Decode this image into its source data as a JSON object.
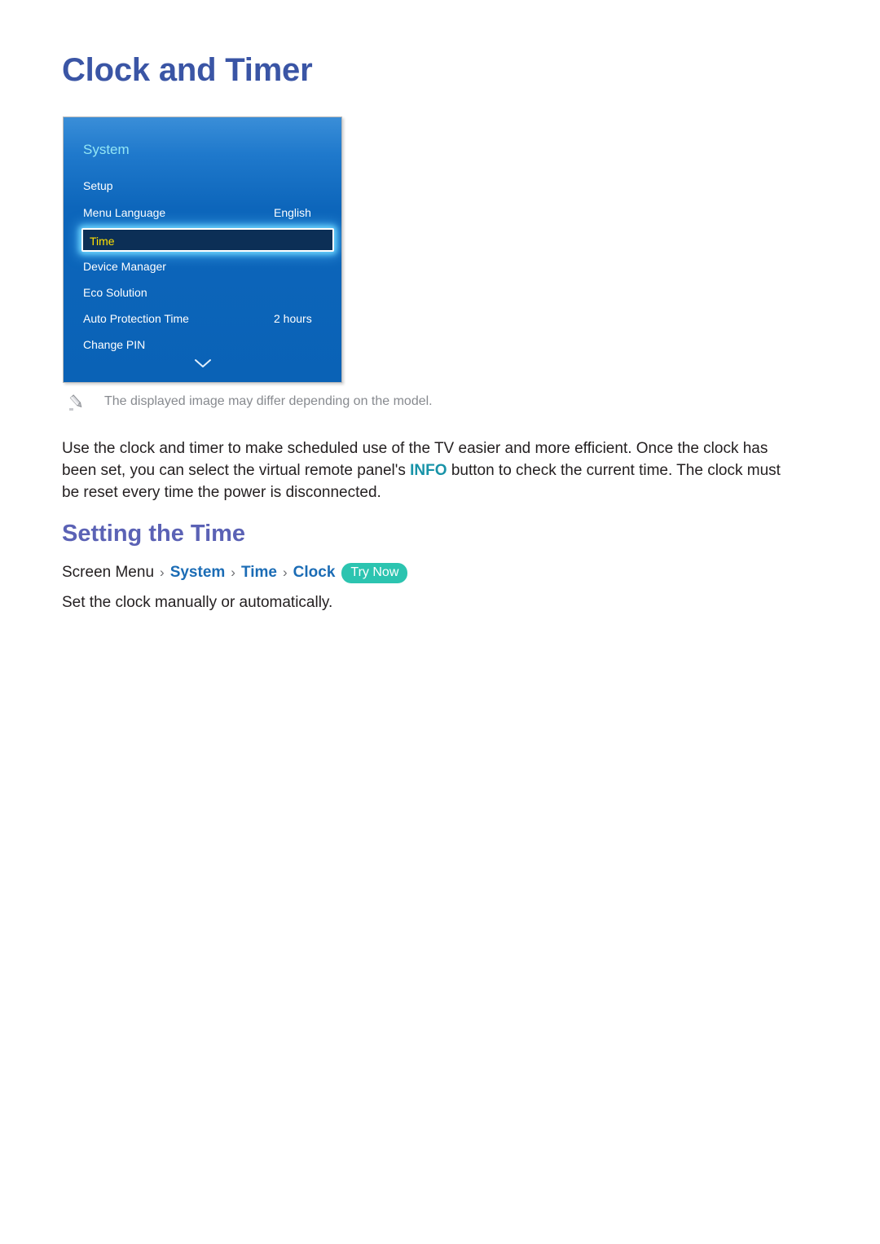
{
  "page": {
    "title": "Clock and Timer"
  },
  "tv_menu": {
    "heading": "System",
    "rows": [
      {
        "label": "Setup",
        "value": "",
        "selected": false
      },
      {
        "label": "Menu Language",
        "value": "English",
        "selected": false
      },
      {
        "label": "Time",
        "value": "",
        "selected": true
      },
      {
        "label": "Device Manager",
        "value": "",
        "selected": false
      },
      {
        "label": "Eco Solution",
        "value": "",
        "selected": false
      },
      {
        "label": "Auto Protection Time",
        "value": "2 hours",
        "selected": false
      },
      {
        "label": "Change PIN",
        "value": "",
        "selected": false
      }
    ],
    "scroll_indicator": "chevron-down-icon",
    "colors": {
      "panel_top": "#3a8ed8",
      "panel_bottom": "#0a62b6",
      "heading_text": "#93e6f5",
      "row_text": "#ffffff",
      "selected_fill": "#0c2f56",
      "selected_text": "#ffe000",
      "selected_border": "#ffffff",
      "selected_glow": "#6ed7ff"
    }
  },
  "note": {
    "icon": "pencil-icon",
    "text": "The displayed image may differ depending on the model."
  },
  "body": {
    "part1": "Use the clock and timer to make scheduled use of the TV easier and more efficient. Once the clock has been set, you can select the virtual remote panel's ",
    "keyword": "INFO",
    "part2": " button to check the current time. The clock must be reset every time the power is disconnected."
  },
  "section": {
    "title": "Setting the Time",
    "breadcrumb": {
      "root": "Screen Menu",
      "sep": "›",
      "links": [
        "System",
        "Time",
        "Clock"
      ],
      "badge": "Try Now",
      "badge_color": "#2cc4b0"
    },
    "description": "Set the clock manually or automatically."
  }
}
